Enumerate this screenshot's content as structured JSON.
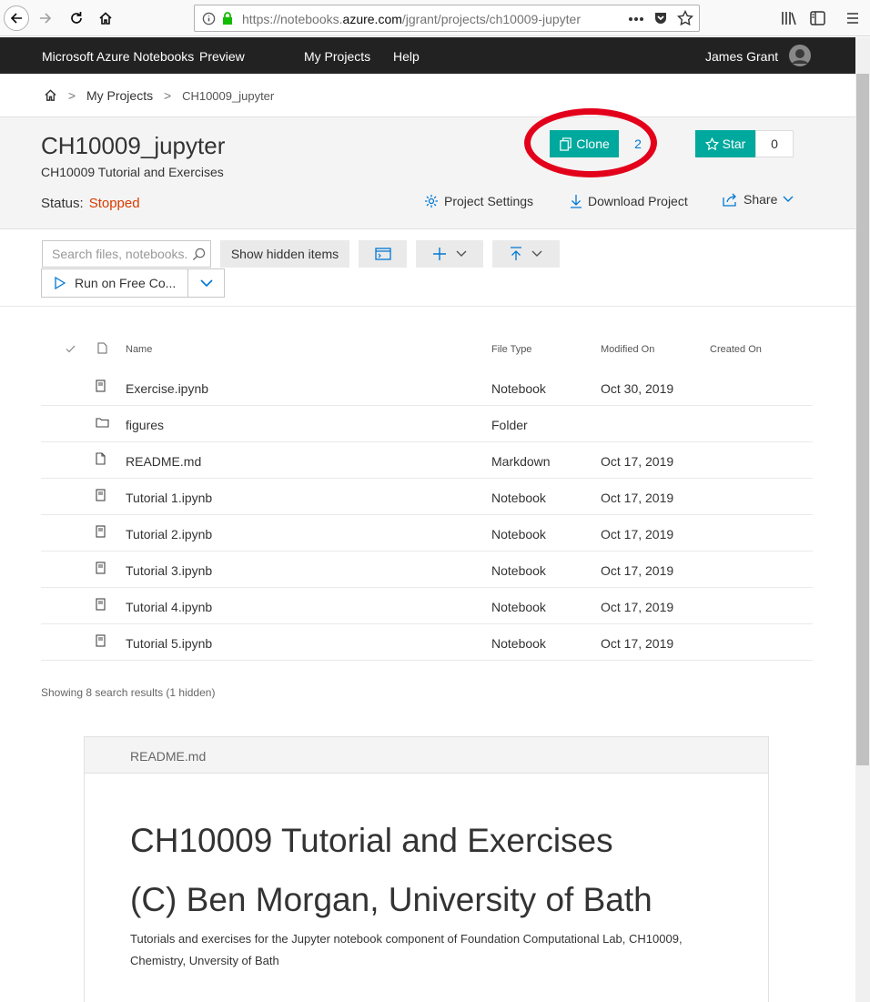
{
  "browser": {
    "url_prefix": "https://notebooks.",
    "url_domain": "azure.com",
    "url_path": "/jgrant/projects/ch10009-jupyter"
  },
  "site_nav": {
    "brand": "Microsoft Azure Notebooks",
    "preview": "Preview",
    "my_projects": "My Projects",
    "help": "Help",
    "user": "James Grant"
  },
  "breadcrumb": {
    "home_sep": ">",
    "my_projects": "My Projects",
    "sep": ">",
    "current": "CH10009_jupyter"
  },
  "project": {
    "title": "CH10009_jupyter",
    "description": "CH10009 Tutorial and Exercises",
    "status_label": "Status:",
    "status_value": "Stopped",
    "clone_label": "Clone",
    "clone_count": "2",
    "star_label": "Star",
    "star_count": "0",
    "settings_label": "Project Settings",
    "download_label": "Download Project",
    "share_label": "Share"
  },
  "toolbar": {
    "search_placeholder": "Search files, notebooks..",
    "show_hidden": "Show hidden items",
    "run_label": "Run on Free Co..."
  },
  "table": {
    "headers": {
      "name": "Name",
      "type": "File Type",
      "modified": "Modified On",
      "created": "Created On"
    },
    "rows": [
      {
        "name": "Exercise.ipynb",
        "type": "Notebook",
        "modified": "Oct 30, 2019",
        "icon": "notebook-icon"
      },
      {
        "name": "figures",
        "type": "Folder",
        "modified": "",
        "icon": "folder-icon"
      },
      {
        "name": "README.md",
        "type": "Markdown",
        "modified": "Oct 17, 2019",
        "icon": "file-icon"
      },
      {
        "name": "Tutorial 1.ipynb",
        "type": "Notebook",
        "modified": "Oct 17, 2019",
        "icon": "notebook-icon"
      },
      {
        "name": "Tutorial 2.ipynb",
        "type": "Notebook",
        "modified": "Oct 17, 2019",
        "icon": "notebook-icon"
      },
      {
        "name": "Tutorial 3.ipynb",
        "type": "Notebook",
        "modified": "Oct 17, 2019",
        "icon": "notebook-icon"
      },
      {
        "name": "Tutorial 4.ipynb",
        "type": "Notebook",
        "modified": "Oct 17, 2019",
        "icon": "notebook-icon"
      },
      {
        "name": "Tutorial 5.ipynb",
        "type": "Notebook",
        "modified": "Oct 17, 2019",
        "icon": "notebook-icon"
      }
    ]
  },
  "results_count": "Showing 8 search results (1 hidden)",
  "readme": {
    "file_name": "README.md",
    "heading1": "CH10009 Tutorial and Exercises",
    "heading2": "(C) Ben Morgan, University of Bath",
    "paragraph": "Tutorials and exercises for the Jupyter notebook component of Foundation Computational Lab, CH10009, Chemistry, Unversity of Bath"
  },
  "colors": {
    "accent": "#00a99d",
    "status_stopped": "#d83b01",
    "highlight_ring": "#e3001b",
    "nav_bg": "#222222"
  }
}
